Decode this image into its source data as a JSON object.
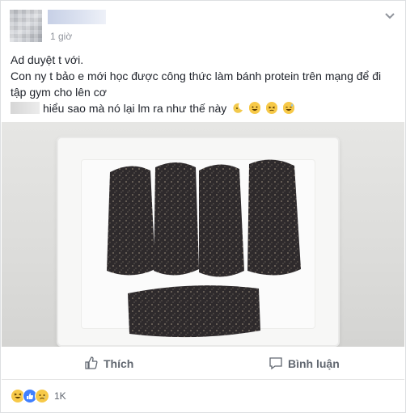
{
  "post": {
    "time": "1 giờ",
    "text": {
      "line1": "Ad duyệt t với.",
      "line2": "Con ny t bảo e mới học được công thức làm bánh protein trên mạng để đi tập gym cho lên cơ",
      "line3": "hiểu sao mà nó lại lm ra như thế này"
    }
  },
  "actions": {
    "like_label": "Thích",
    "comment_label": "Bình luận"
  },
  "reactions": {
    "count": "1K",
    "types": [
      "haha",
      "like",
      "sad"
    ]
  },
  "colors": {
    "text": "#1d2129",
    "muted": "#90949c",
    "action": "#616770",
    "like_blue": "#4080ff",
    "haha_yellow": "#f7c948"
  },
  "icons": [
    "more-icon",
    "like-icon",
    "comment-icon"
  ]
}
